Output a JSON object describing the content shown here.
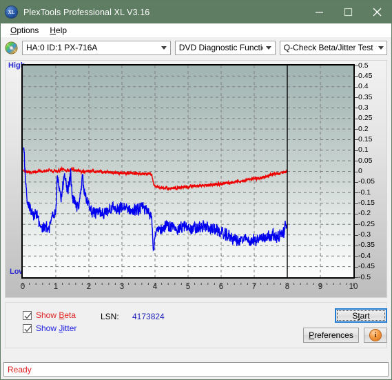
{
  "window": {
    "title": "PlexTools Professional XL V3.16",
    "app_icon": "xl-logo-icon",
    "minimize": "minimize-icon",
    "maximize": "maximize-icon",
    "close": "close-icon",
    "titlebar_color": "#5f7d62"
  },
  "menu": {
    "items": [
      {
        "label": "Options",
        "accel": "O"
      },
      {
        "label": "Help",
        "accel": "H"
      }
    ]
  },
  "toolbar": {
    "drive_icon": "optical-disc-icon",
    "drive_select": "HA:0 ID:1  PX-716A",
    "function_select": "DVD Diagnostic Functions",
    "test_select": "Q-Check Beta/Jitter Test"
  },
  "chart_panel": {
    "label_high": "High",
    "label_low": "Low"
  },
  "controls": {
    "show_beta": {
      "label": "Show Beta",
      "accel": "B",
      "checked": true,
      "color": "#e02020"
    },
    "show_jitter": {
      "label": "Show Jitter",
      "accel": "J",
      "checked": true,
      "color": "#2020e0"
    },
    "lsn_label": "LSN:",
    "lsn_value": "4173824",
    "start_button": "Start",
    "start_accel": "t",
    "preferences_button": "Preferences",
    "preferences_accel": "P",
    "info_button": "info-icon"
  },
  "statusbar": {
    "text": "Ready",
    "color": "#e02020"
  },
  "chart_data": {
    "type": "line",
    "title": "Q-Check Beta/Jitter Test",
    "xlabel": "",
    "ylabel": "",
    "xlim": [
      0,
      10
    ],
    "ylim": [
      -0.5,
      0.5
    ],
    "grid": true,
    "legend_position": "bottom-left",
    "x_ticks": [
      "0",
      "1",
      "2",
      "3",
      "4",
      "5",
      "6",
      "7",
      "8",
      "9",
      "10"
    ],
    "y_ticks": [
      "0.5",
      "0.45",
      "0.4",
      "0.35",
      "0.3",
      "0.25",
      "0.2",
      "0.15",
      "0.1",
      "0.05",
      "0",
      "-0.05",
      "-0.1",
      "-0.15",
      "-0.2",
      "-0.25",
      "-0.3",
      "-0.35",
      "-0.4",
      "-0.45",
      "-0.5"
    ],
    "y_axis_left_labels": [
      "High",
      "Low"
    ],
    "marker_line_x": 8,
    "data_end_x": 8,
    "series": [
      {
        "name": "Beta",
        "color": "#ee0000",
        "x": [
          0.02,
          0.1,
          0.2,
          0.3,
          0.4,
          0.5,
          0.6,
          0.7,
          0.8,
          0.9,
          1.0,
          1.1,
          1.2,
          1.3,
          1.4,
          1.5,
          1.6,
          1.7,
          1.8,
          1.9,
          2.0,
          2.1,
          2.2,
          2.3,
          2.4,
          2.5,
          2.6,
          2.7,
          2.8,
          2.9,
          3.0,
          3.1,
          3.2,
          3.3,
          3.4,
          3.5,
          3.6,
          3.7,
          3.8,
          3.9,
          3.97,
          4.05,
          4.2,
          4.4,
          4.6,
          4.8,
          5.0,
          5.2,
          5.4,
          5.6,
          5.8,
          6.0,
          6.2,
          6.4,
          6.6,
          6.8,
          7.0,
          7.2,
          7.4,
          7.6,
          7.8,
          7.95
        ],
        "y": [
          0.005,
          0.0,
          -0.005,
          -0.005,
          0.0,
          0.0,
          0.0,
          0.005,
          0.005,
          0.0,
          0.0,
          0.005,
          0.01,
          0.005,
          0.005,
          0.01,
          0.005,
          0.0,
          0.0,
          0.0,
          0.0,
          0.0,
          -0.002,
          -0.002,
          -0.003,
          -0.004,
          -0.005,
          -0.005,
          -0.006,
          -0.006,
          -0.007,
          -0.008,
          -0.008,
          -0.009,
          -0.01,
          -0.01,
          -0.011,
          -0.012,
          -0.013,
          -0.013,
          -0.07,
          -0.075,
          -0.078,
          -0.08,
          -0.077,
          -0.075,
          -0.072,
          -0.07,
          -0.068,
          -0.065,
          -0.062,
          -0.058,
          -0.054,
          -0.05,
          -0.046,
          -0.04,
          -0.035,
          -0.03,
          -0.022,
          -0.012,
          -0.008,
          -0.002
        ],
        "noise_amplitude": 0.012
      },
      {
        "name": "Jitter",
        "color": "#0000ee",
        "x": [
          0.02,
          0.05,
          0.12,
          0.2,
          0.3,
          0.4,
          0.5,
          0.6,
          0.7,
          0.8,
          0.9,
          1.0,
          1.05,
          1.15,
          1.25,
          1.35,
          1.45,
          1.5,
          1.6,
          1.7,
          1.8,
          1.9,
          2.0,
          2.1,
          2.2,
          2.3,
          2.4,
          2.5,
          2.6,
          2.7,
          2.8,
          2.9,
          3.0,
          3.2,
          3.4,
          3.6,
          3.8,
          3.9,
          3.95,
          4.0,
          4.1,
          4.3,
          4.5,
          4.7,
          4.9,
          5.1,
          5.3,
          5.5,
          5.7,
          5.9,
          6.1,
          6.3,
          6.5,
          6.7,
          6.9,
          7.1,
          7.3,
          7.5,
          7.7,
          7.9,
          7.97
        ],
        "y": [
          0.125,
          0.06,
          -0.12,
          -0.17,
          -0.21,
          -0.2,
          -0.24,
          -0.27,
          -0.26,
          -0.28,
          -0.2,
          -0.18,
          -0.02,
          -0.14,
          -0.02,
          -0.1,
          -0.01,
          -0.12,
          -0.16,
          -0.17,
          -0.02,
          -0.12,
          -0.17,
          -0.19,
          -0.2,
          -0.19,
          -0.21,
          -0.2,
          -0.18,
          -0.17,
          -0.18,
          -0.19,
          -0.17,
          -0.18,
          -0.19,
          -0.17,
          -0.19,
          -0.2,
          -0.38,
          -0.3,
          -0.28,
          -0.26,
          -0.26,
          -0.27,
          -0.26,
          -0.27,
          -0.27,
          -0.26,
          -0.27,
          -0.28,
          -0.3,
          -0.31,
          -0.33,
          -0.32,
          -0.33,
          -0.32,
          -0.31,
          -0.3,
          -0.31,
          -0.29,
          -0.25
        ],
        "noise_amplitude": 0.045
      }
    ]
  }
}
